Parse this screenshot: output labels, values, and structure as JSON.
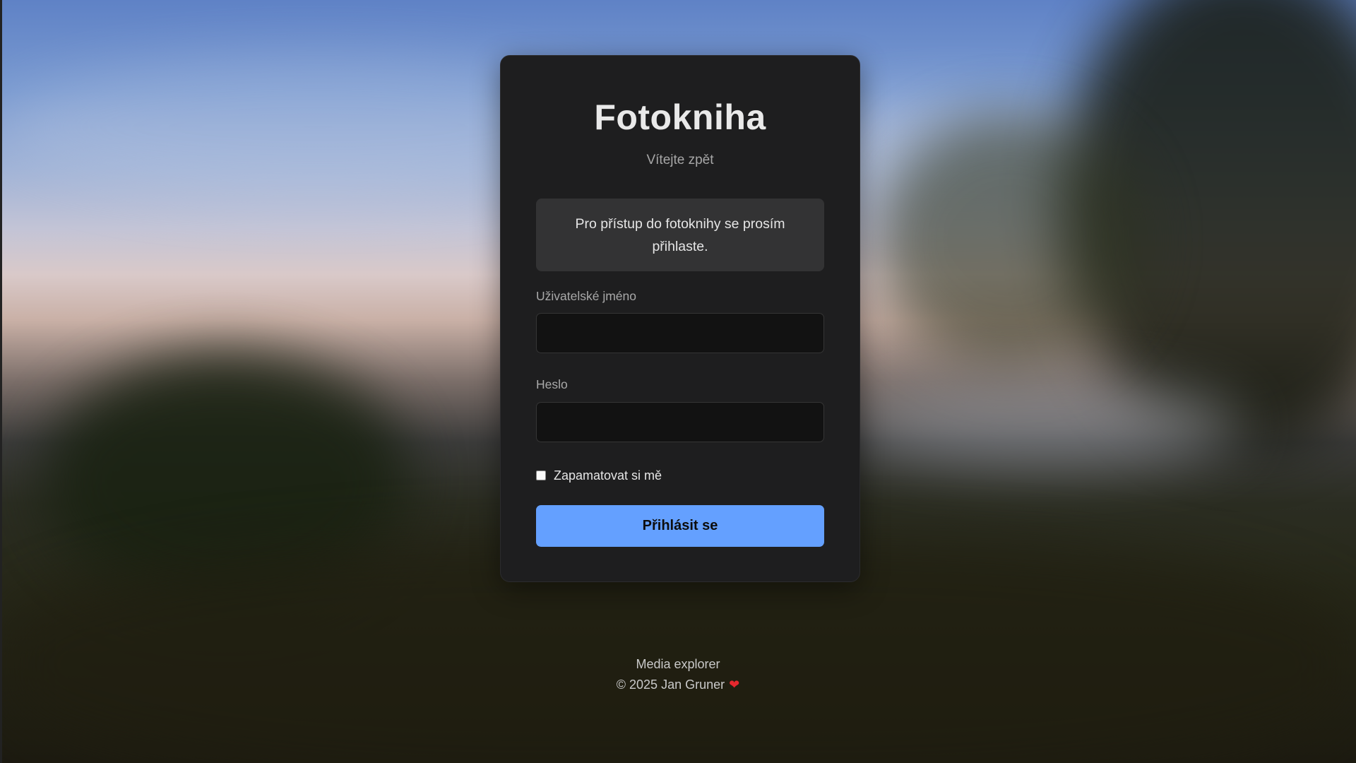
{
  "app": {
    "title": "Fotokniha",
    "subtitle": "Vítejte zpět"
  },
  "login": {
    "notice": "Pro přístup do fotoknihy se prosím přihlaste.",
    "username_label": "Uživatelské jméno",
    "username_value": "",
    "password_label": "Heslo",
    "password_value": "",
    "remember_label": "Zapamatovat si mě",
    "remember_checked": false,
    "submit_label": "Přihlásit se"
  },
  "footer": {
    "line1": "Media explorer",
    "line2": "© 2025 Jan Gruner",
    "heart_icon": "heart-icon"
  },
  "colors": {
    "accent": "#64a0ff",
    "card_background": "#1e1e1f",
    "heart": "#e5282e"
  }
}
